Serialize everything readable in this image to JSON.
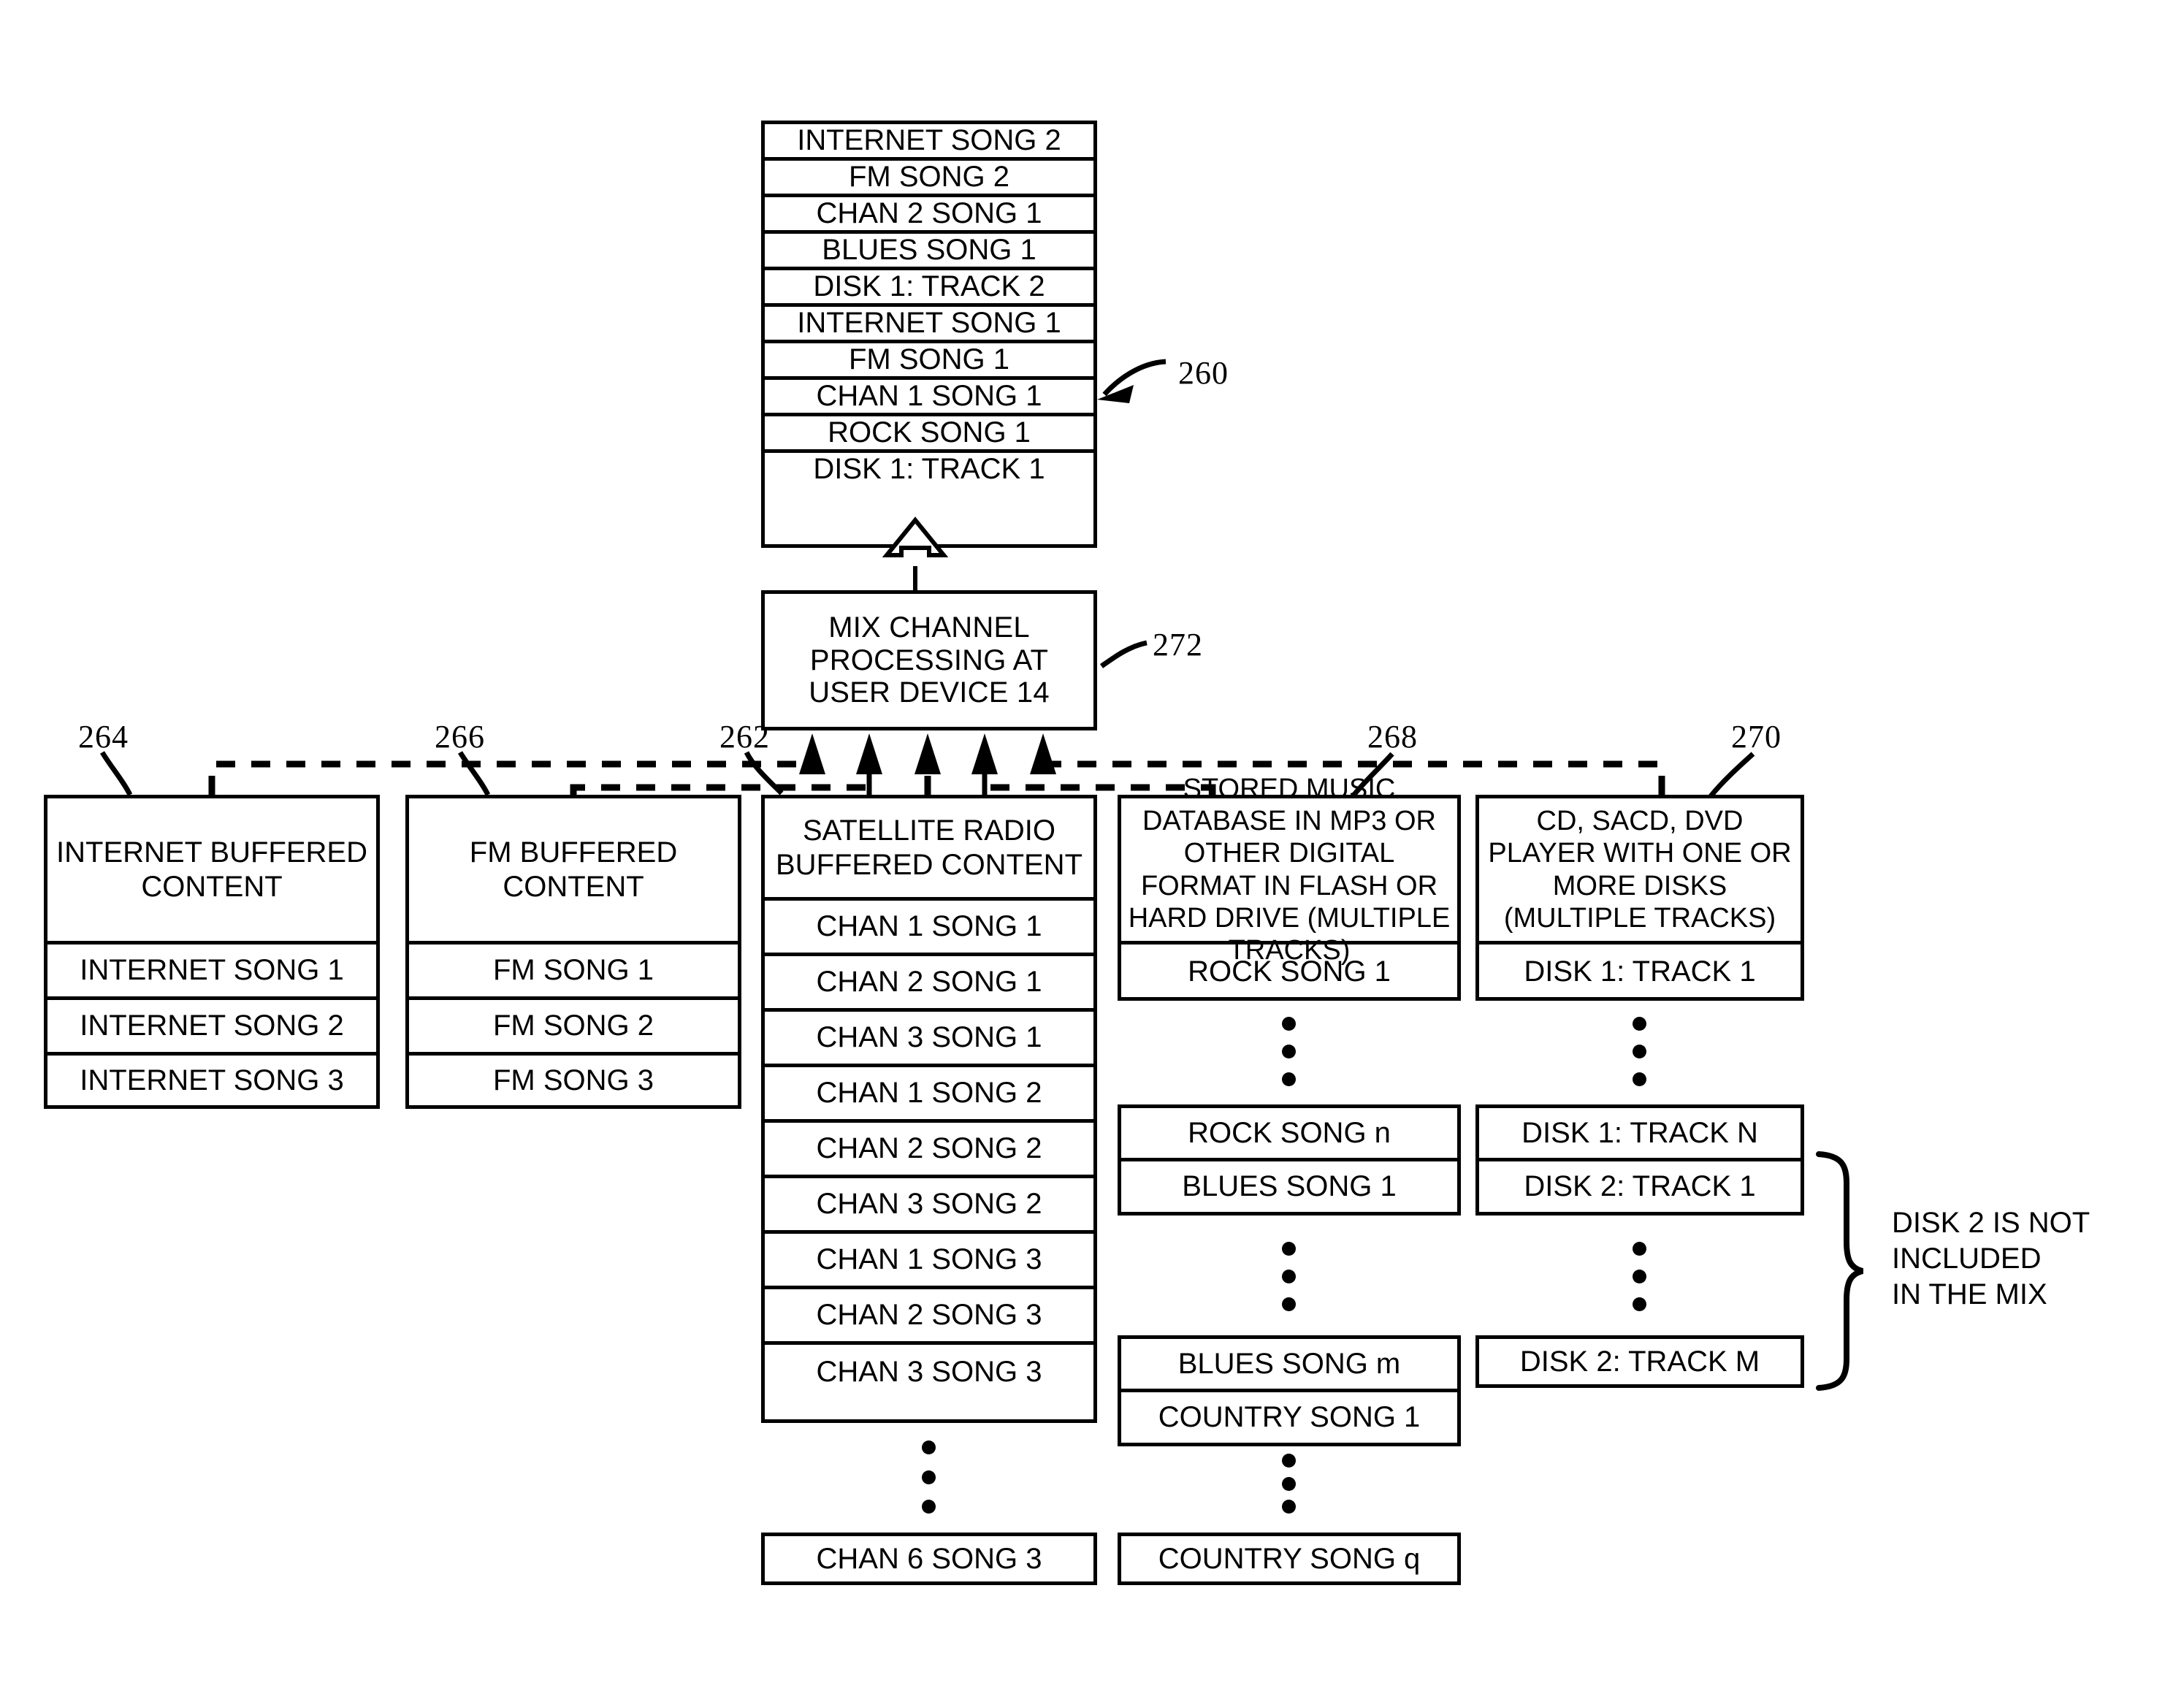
{
  "figure": {
    "mix_output": {
      "ref": "260",
      "rows": [
        "INTERNET SONG 2",
        "FM SONG 2",
        "CHAN 2 SONG 1",
        "BLUES SONG 1",
        "DISK 1: TRACK 2",
        "INTERNET SONG 1",
        "FM SONG 1",
        "CHAN 1 SONG 1",
        "ROCK SONG 1",
        "DISK 1: TRACK 1"
      ]
    },
    "processor": {
      "ref": "272",
      "label": "MIX CHANNEL PROCESSING AT USER DEVICE 14"
    },
    "sources": [
      {
        "ref": "264",
        "title": "INTERNET BUFFERED CONTENT",
        "rows": [
          "INTERNET SONG 1",
          "INTERNET SONG 2",
          "INTERNET SONG 3"
        ],
        "tail": []
      },
      {
        "ref": "266",
        "title": "FM BUFFERED CONTENT",
        "rows": [
          "FM SONG 1",
          "FM SONG 2",
          "FM SONG 3"
        ],
        "tail": []
      },
      {
        "ref": "262",
        "title": "SATELLITE RADIO BUFFERED CONTENT",
        "rows": [
          "CHAN 1 SONG 1",
          "CHAN 2 SONG 1",
          "CHAN 3 SONG 1",
          "CHAN 1 SONG 2",
          "CHAN 2 SONG 2",
          "CHAN 3 SONG 2",
          "CHAN 1 SONG 3",
          "CHAN 2 SONG 3",
          "CHAN 3 SONG 3"
        ],
        "tail": [
          "CHAN 6 SONG 3"
        ]
      },
      {
        "ref": "268",
        "title": "STORED MUSIC DATABASE IN MP3 OR OTHER DIGITAL FORMAT IN FLASH OR HARD DRIVE (MULTIPLE TRACKS)",
        "rows": [
          "ROCK SONG 1"
        ],
        "tail": [
          "ROCK SONG n",
          "BLUES SONG 1",
          "BLUES SONG m",
          "COUNTRY SONG 1",
          "COUNTRY SONG q"
        ]
      },
      {
        "ref": "270",
        "title": "CD, SACD, DVD PLAYER WITH ONE OR MORE DISKS (MULTIPLE TRACKS)",
        "rows": [
          "DISK 1: TRACK 1"
        ],
        "tail": [
          "DISK 1: TRACK N",
          "DISK 2: TRACK 1",
          "DISK 2: TRACK M"
        ]
      }
    ],
    "annotation": {
      "text": "DISK 2 IS NOT\nINCLUDED\nIN THE MIX"
    }
  }
}
